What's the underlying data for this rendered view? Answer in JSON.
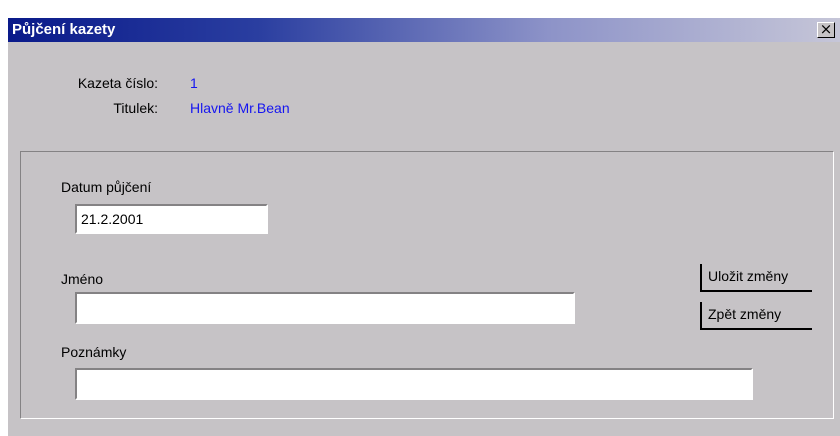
{
  "window": {
    "title": "Půjčení kazety",
    "close_glyph": "×"
  },
  "info": {
    "cassette_label": "Kazeta číslo:",
    "cassette_value": "1",
    "title_label": "Titulek:",
    "title_value": "Hlavně Mr.Bean"
  },
  "form": {
    "date_label": "Datum půjčení",
    "date_value": "21.2.2001",
    "name_label": "Jméno",
    "name_value": "",
    "notes_label": "Poznámky",
    "notes_value": ""
  },
  "buttons": {
    "save_label": "Uložit změny",
    "revert_label": "Zpět změny"
  }
}
